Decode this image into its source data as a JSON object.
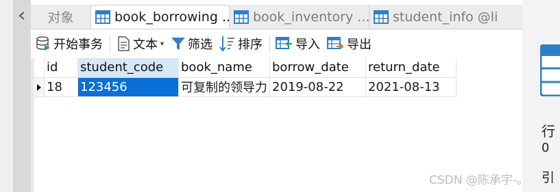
{
  "tabs": {
    "objects_label": "对象",
    "items": [
      {
        "label": "book_borrowing ...",
        "active": true
      },
      {
        "label": "book_inventory ...",
        "active": false
      },
      {
        "label": "student_info @li",
        "active": false
      }
    ]
  },
  "toolbar": {
    "begin_transaction": "开始事务",
    "text": "文本",
    "filter": "筛选",
    "sort": "排序",
    "import": "导入",
    "export": "导出"
  },
  "grid": {
    "columns": [
      "id",
      "student_code",
      "book_name",
      "borrow_date",
      "return_date"
    ],
    "rows": [
      {
        "id": "18",
        "student_code": "123456",
        "book_name": "可复制的领导力",
        "borrow_date": "2019-08-22",
        "return_date": "2021-08-13"
      }
    ]
  },
  "info_panel": {
    "rows_label": "行",
    "rows_value": "0",
    "ref_label": "引",
    "ref_prefix": "。"
  },
  "watermark": "CSDN @陈承宇-",
  "colors": {
    "selection": "#0a6fd6",
    "selected_column_header": "#d6e7f7",
    "table_icon_blue": "#2f7fc8"
  }
}
